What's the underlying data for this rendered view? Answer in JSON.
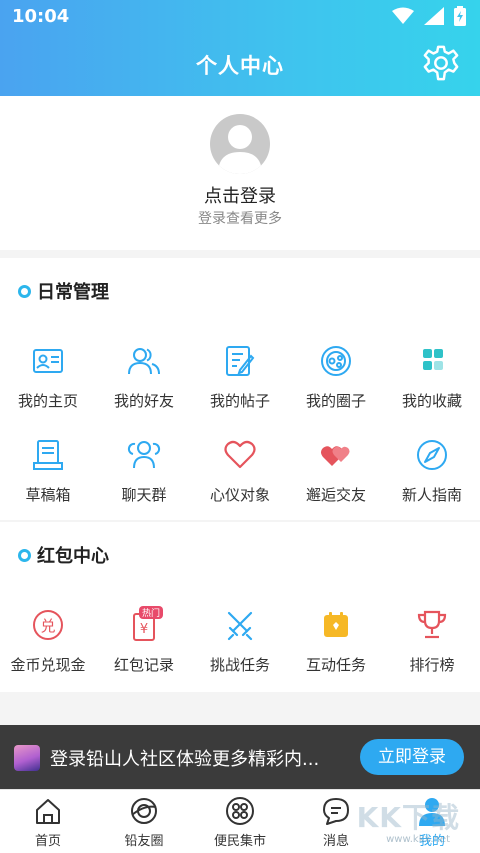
{
  "status": {
    "time": "10:04"
  },
  "header": {
    "title": "个人中心"
  },
  "profile": {
    "login": "点击登录",
    "sub": "登录查看更多"
  },
  "daily": {
    "title": "日常管理",
    "items": [
      {
        "label": "我的主页"
      },
      {
        "label": "我的好友"
      },
      {
        "label": "我的帖子"
      },
      {
        "label": "我的圈子"
      },
      {
        "label": "我的收藏"
      },
      {
        "label": "草稿箱"
      },
      {
        "label": "聊天群"
      },
      {
        "label": "心仪对象"
      },
      {
        "label": "邂逅交友"
      },
      {
        "label": "新人指南"
      }
    ]
  },
  "redpacket": {
    "title": "红包中心",
    "items": [
      {
        "label": "金币兑现金",
        "glyph": "兑"
      },
      {
        "label": "红包记录",
        "glyph": "¥",
        "badge": "热门"
      },
      {
        "label": "挑战任务"
      },
      {
        "label": "互动任务"
      },
      {
        "label": "排行榜"
      }
    ]
  },
  "banner": {
    "text": "登录铅山人社区体验更多精彩内...",
    "button": "立即登录"
  },
  "tabs": [
    {
      "label": "首页"
    },
    {
      "label": "铅友圈"
    },
    {
      "label": "便民集市"
    },
    {
      "label": "消息"
    },
    {
      "label": "我的"
    }
  ],
  "watermark": {
    "text": "KK下载",
    "sub": "www.kkx.net"
  },
  "colors": {
    "accent": "#2ea9f1",
    "red": "#e5545c",
    "teal": "#3fc3ee"
  }
}
